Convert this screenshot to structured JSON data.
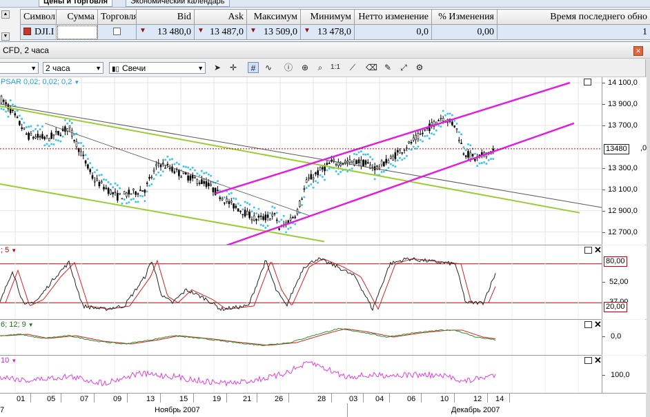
{
  "tabs": [
    {
      "label": "Цены и торговля",
      "active": true
    },
    {
      "label": "Экономический календарь",
      "active": false
    }
  ],
  "quote_table": {
    "headers": [
      "Символ",
      "Сумма",
      "Торговля",
      "Bid",
      "Ask",
      "Максимум",
      "Минимум",
      "Нетто изменение",
      "% Изменения",
      "Время последнего обно"
    ],
    "row": {
      "symbol": "DJI.I",
      "amount": "",
      "bid": "13 480,0",
      "ask": "13 487,0",
      "high": "13 509,0",
      "low": "13 478,0",
      "net_change": "0,0",
      "pct_change": "0,00",
      "last_update": "1"
    }
  },
  "window": {
    "title": "CFD, 2 часа",
    "close_glyph": "✕"
  },
  "toolbar": {
    "instrument_value": "",
    "timeframe_value": "2 часа",
    "chart_type_value": "Свечи",
    "icons": [
      "cursor-icon",
      "crosshair-icon",
      "grid-icon",
      "indicator-icon",
      "info-icon",
      "zoom-icon",
      "fit-icon",
      "draw-line-icon",
      "eraser-icon",
      "paint-icon",
      "autoscale-icon",
      "settings-icon"
    ]
  },
  "main_pane": {
    "label": "PSAR 0,02; 0,02; 0,2",
    "y_ticks": [
      "14 100,0",
      "13 900,0",
      "13 700,0",
      "13 300,0",
      "13 100,0",
      "12 900,0",
      "12 700,0"
    ],
    "y_ticks_data": [
      14100,
      13900,
      13700,
      13300,
      13100,
      12900,
      12700
    ],
    "partial_tick": ",0",
    "price_badge": "13480",
    "price_line": 13480,
    "y_range": [
      12600,
      14100
    ]
  },
  "stochastic_pane": {
    "label": "; 5",
    "y_ticks": [
      "52,00"
    ],
    "badges": [
      "80,00",
      "20,00"
    ],
    "partial_tick": "37,00",
    "levels": [
      80,
      20
    ]
  },
  "macd_pane": {
    "label": "6; 12; 9",
    "y_ticks": [
      "0,0"
    ]
  },
  "cci_pane": {
    "label": "10",
    "y_ticks": [
      "100,0"
    ]
  },
  "time_axis": {
    "day_labels": [
      "01",
      "05",
      "07",
      "09",
      "13",
      "15",
      "19",
      "21",
      "26",
      "28",
      "03",
      "04",
      "06",
      "10",
      "12",
      "14"
    ],
    "month_labels": [
      "Ноябрь 2007",
      "Декабрь 2007"
    ],
    "edge_label": "7"
  },
  "colors": {
    "psar": "#3fc6e8",
    "channel_magenta": "#e01ee0",
    "channel_green": "#9acd32",
    "price_line": "#c00000",
    "stoch_red": "#d42020",
    "macd_green": "#2a8f2a",
    "cci": "#e040e0",
    "active_cell": "#dde8f6"
  }
}
